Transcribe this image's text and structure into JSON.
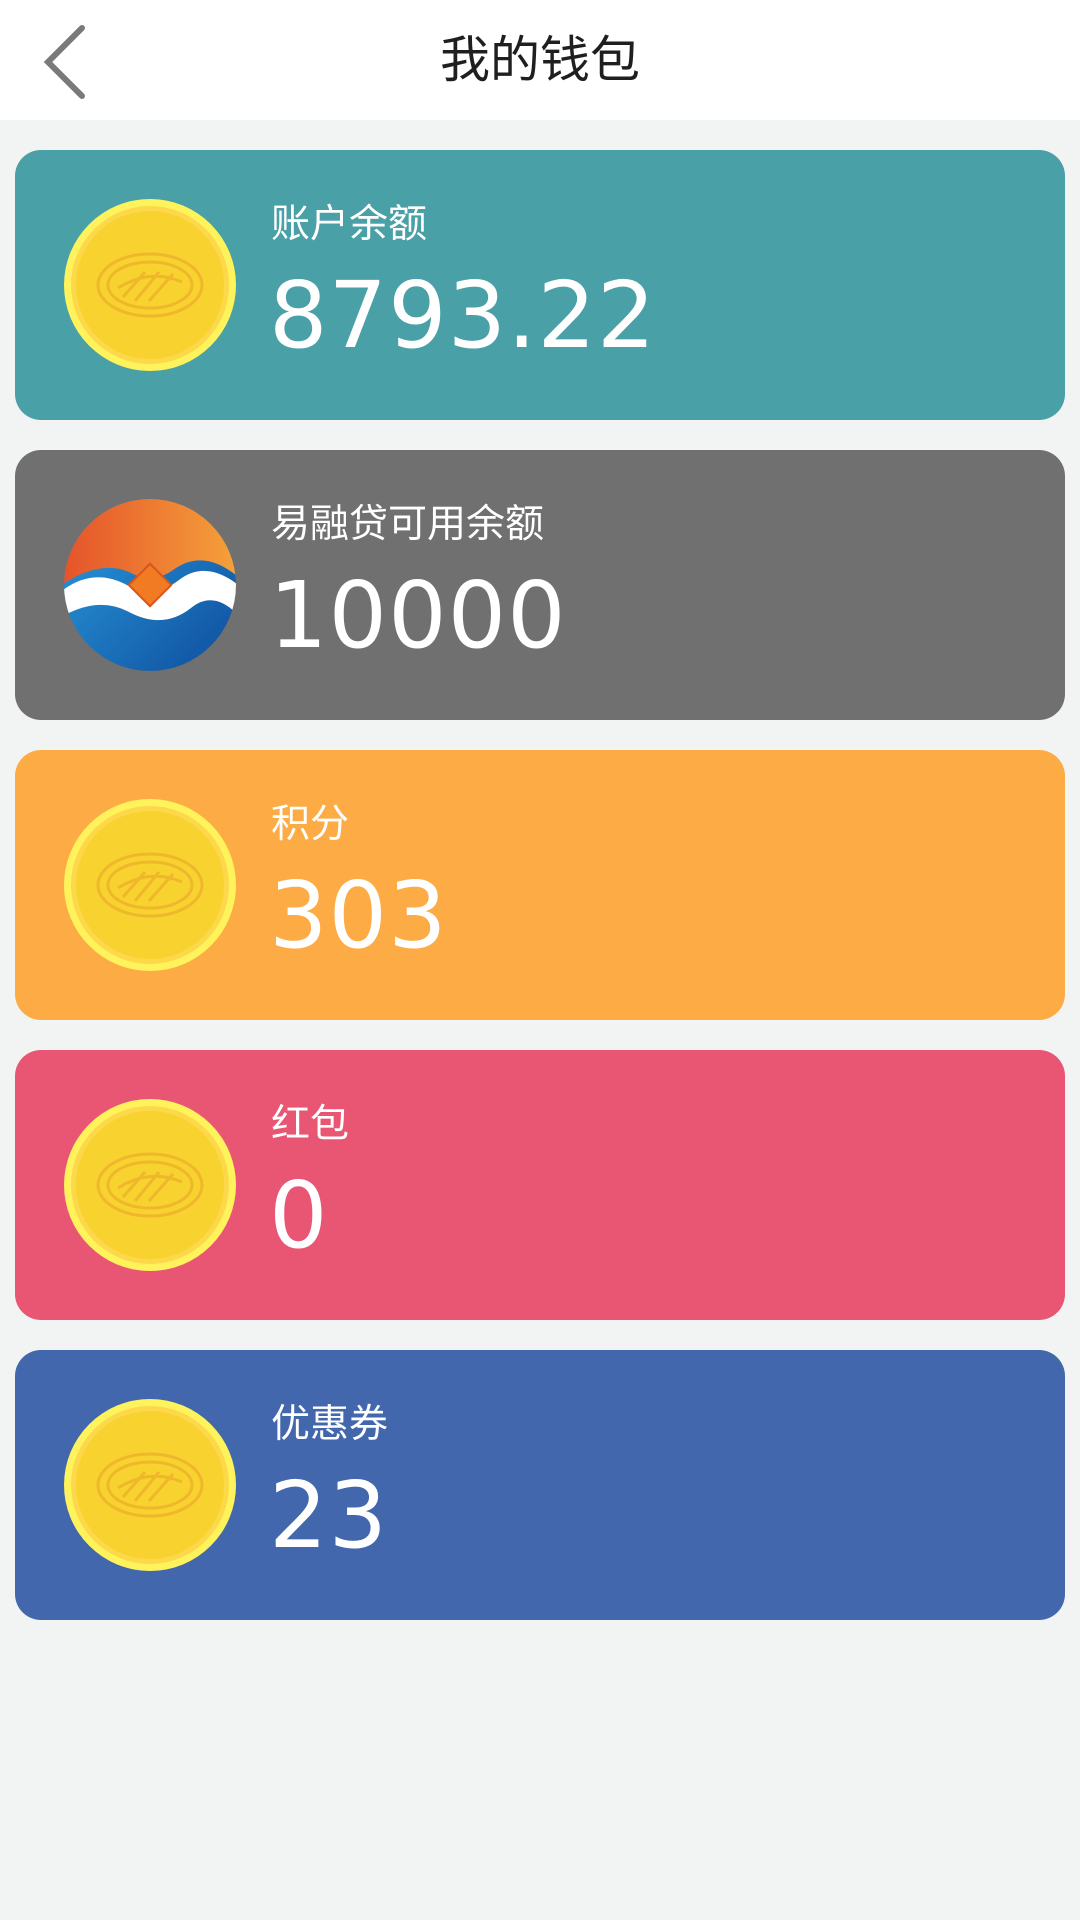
{
  "header": {
    "title": "我的钱包",
    "back_icon": "chevron-left-icon"
  },
  "cards": [
    {
      "label": "账户余额",
      "value": "8793.22",
      "color": "#4aa0a7",
      "icon": "gold-coin-icon"
    },
    {
      "label": "易融贷可用余额",
      "value": "10000",
      "color": "#707070",
      "icon": "brand-logo-icon"
    },
    {
      "label": "积分",
      "value": "303",
      "color": "#fdab45",
      "icon": "gold-coin-icon"
    },
    {
      "label": "红包",
      "value": "0",
      "color": "#e95674",
      "icon": "gold-coin-icon"
    },
    {
      "label": "优惠券",
      "value": "23",
      "color": "#4367ad",
      "icon": "gold-coin-icon"
    }
  ]
}
